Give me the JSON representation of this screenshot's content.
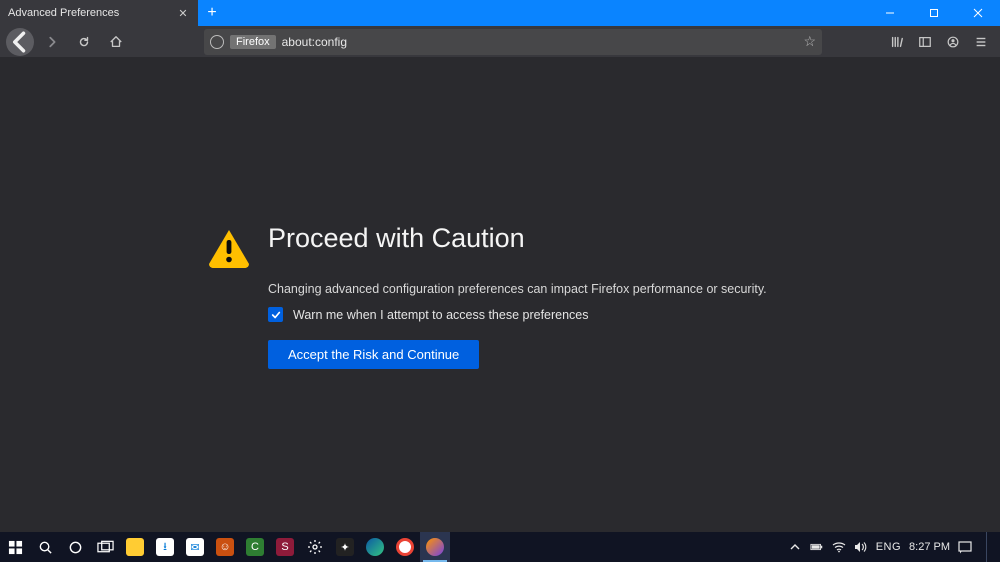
{
  "titlebar": {
    "tab_title": "Advanced Preferences"
  },
  "urlbar": {
    "identity_label": "Firefox",
    "address": "about:config"
  },
  "content": {
    "heading": "Proceed with Caution",
    "description": "Changing advanced configuration preferences can impact Firefox performance or security.",
    "checkbox_label": "Warn me when I attempt to access these preferences",
    "accept_label": "Accept the Risk and Continue"
  },
  "taskbar": {
    "language": "ENG",
    "clock": "8:27 PM"
  }
}
